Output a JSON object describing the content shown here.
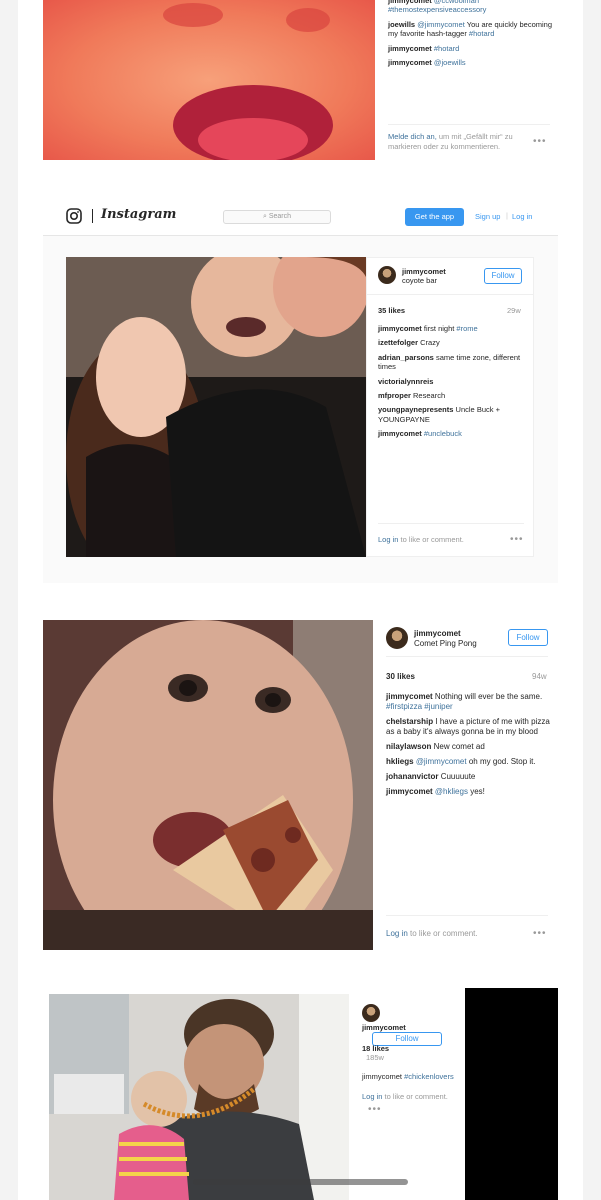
{
  "post1": {
    "comments": [
      {
        "user": "jimmycomet",
        "text": "@ccwoolman #themostexpensiveaccessory"
      },
      {
        "user": "joewills",
        "text": "@jimmycomet You are quickly becoming my favorite hash-tagger #hotard"
      },
      {
        "user": "jimmycomet",
        "text": "#hotard"
      },
      {
        "user": "jimmycomet",
        "text": "@joewills"
      }
    ],
    "login_link": "Melde dich an,",
    "login_text": " um mit „Gefällt mir“ zu markieren oder zu kommentieren.",
    "more": "•••"
  },
  "header": {
    "logo_text": "Instagram",
    "search_placeholder": "Search",
    "get_app": "Get the app",
    "signup": "Sign up",
    "separator": "|",
    "login": "Log in"
  },
  "post2": {
    "username": "jimmycomet",
    "location": "coyote bar",
    "follow": "Follow",
    "likes": "35 likes",
    "ago": "29w",
    "comments": [
      {
        "user": "jimmycomet",
        "text": "first night #rome"
      },
      {
        "user": "izettefolger",
        "text": "Crazy"
      },
      {
        "user": "adrian_parsons",
        "text": "same time zone, different times"
      },
      {
        "user": "victorialynnreis",
        "text": ""
      },
      {
        "user": "mfproper",
        "text": "Research"
      },
      {
        "user": "youngpaynepresents",
        "text": "Uncle Buck + YOUNGPAYNE"
      },
      {
        "user": "jimmycomet",
        "text": "#unclebuck"
      }
    ],
    "login_link": "Log in",
    "login_text": " to like or comment.",
    "more": "•••"
  },
  "post3": {
    "username": "jimmycomet",
    "location": "Comet Ping Pong",
    "follow": "Follow",
    "likes": "30 likes",
    "ago": "94w",
    "comments": [
      {
        "user": "jimmycomet",
        "text": "Nothing will ever be the same. #firstpizza #juniper"
      },
      {
        "user": "chelstarship",
        "text": "I have a picture of me with pizza as a baby it's always gonna be in my blood"
      },
      {
        "user": "nilaylawson",
        "text": "New comet ad"
      },
      {
        "user": "hkliegs",
        "text": "@jimmycomet oh my god. Stop it."
      },
      {
        "user": "johananvictor",
        "text": "Cuuuuute"
      },
      {
        "user": "jimmycomet",
        "text": "@hkliegs yes!"
      }
    ],
    "login_link": "Log in",
    "login_text": " to like or comment.",
    "more": "•••"
  },
  "post4": {
    "username": "jimmycomet",
    "follow": "Follow",
    "likes": "18 likes",
    "ago": "185w",
    "comments": [
      {
        "user": "jimmycomet",
        "text": "#chickenlovers"
      }
    ],
    "login_link": "Log in",
    "login_text": " to like or comment.",
    "more": "•••"
  }
}
